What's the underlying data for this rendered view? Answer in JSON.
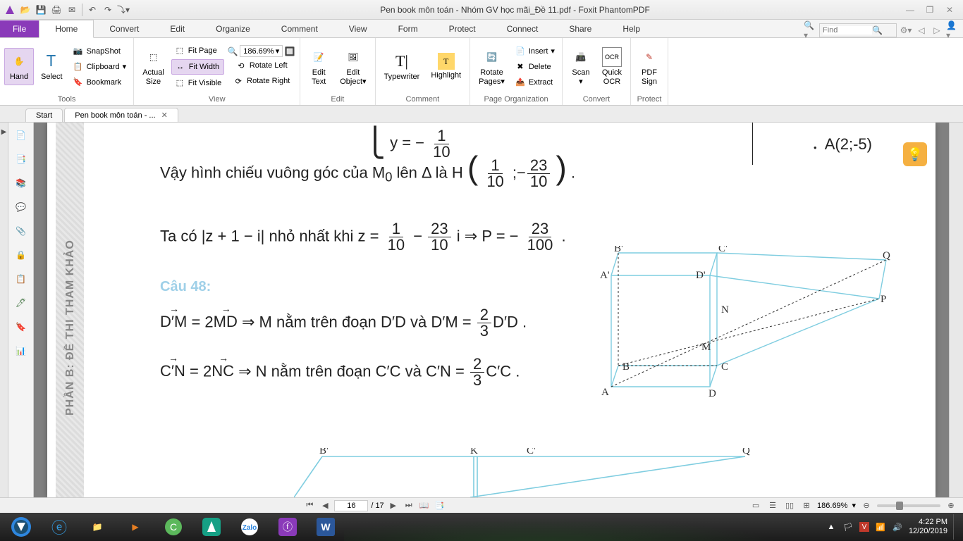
{
  "window": {
    "title": "Pen book môn toán - Nhóm GV học mãi_Đề 11.pdf - Foxit PhantomPDF"
  },
  "ribbon": {
    "file": "File",
    "tabs": [
      "Home",
      "Convert",
      "Edit",
      "Organize",
      "Comment",
      "View",
      "Form",
      "Protect",
      "Connect",
      "Share",
      "Help"
    ],
    "active": "Home",
    "find_placeholder": "Find",
    "zoom_value": "186.69%",
    "groups": {
      "tools": "Tools",
      "view": "View",
      "edit": "Edit",
      "comment": "Comment",
      "page_org": "Page Organization",
      "convert": "Convert",
      "protect": "Protect"
    },
    "btns": {
      "hand": "Hand",
      "select": "Select",
      "snapshot": "SnapShot",
      "clipboard": "Clipboard",
      "bookmark": "Bookmark",
      "actual_size": "Actual\nSize",
      "fit_page": "Fit Page",
      "fit_width": "Fit Width",
      "fit_visible": "Fit Visible",
      "rotate_left": "Rotate Left",
      "rotate_right": "Rotate Right",
      "edit_text": "Edit\nText",
      "edit_object": "Edit\nObject",
      "typewriter": "Typewriter",
      "highlight": "Highlight",
      "rotate_pages": "Rotate\nPages",
      "insert": "Insert",
      "delete": "Delete",
      "extract": "Extract",
      "scan": "Scan",
      "quick_ocr": "Quick\nOCR",
      "pdf_sign": "PDF\nSign"
    }
  },
  "doctabs": {
    "start": "Start",
    "doc": "Pen book môn toán - ..."
  },
  "side_label": "PHẦN B: ĐỀ THI THAM KHẢO",
  "doc": {
    "eq_y": "y = − —10",
    "point_A": "A(2;-5)",
    "line2_pre": "Vậy hình chiếu vuông góc của  M",
    "line2_sub": "0",
    "line2_mid": "  lên  Δ  là  H",
    "h_num1": "1",
    "h_den1": "10",
    "h_sep": ";",
    "h_num2": "23",
    "h_den2": "10",
    "line3_pre": "Ta có ",
    "abs_expr": "|z + 1 − i|",
    "line3_mid": "  nhỏ nhất khi  z = ",
    "z_n1": "1",
    "z_d1": "10",
    "z_minus": " − ",
    "z_n2": "23",
    "z_d2": "10",
    "z_i": "i ⇒ P = −",
    "p_n": "23",
    "p_d": "100",
    "dot": " .",
    "q48": "Câu 48:",
    "dm_l": "D′M",
    "dm_eq": " = 2",
    "md": "MD",
    "dm_arr": "  ⇒ M nằm trên đoạn  D′D  và  D′M = ",
    "dm_n": "2",
    "dm_d": "3",
    "dm_tail": "D′D .",
    "cn_l": "C′N",
    "cn_eq": " = 2",
    "nc": "NC",
    "cn_arr": "  ⇒ N  nằm trên đoạn  C′C  và  C′N = ",
    "cn_n": "2",
    "cn_d": "3",
    "cn_tail": "C′C .",
    "geo_labels": {
      "Bp": "B'",
      "Cp": "C'",
      "Q": "Q",
      "Ap": "A'",
      "Dp": "D'",
      "P": "P",
      "N": "N",
      "M": "M",
      "B": "B",
      "C": "C",
      "A": "A",
      "D": "D",
      "K": "K"
    }
  },
  "status": {
    "page_current": "16",
    "page_total": "/ 17",
    "zoom": "186.69%"
  },
  "systray": {
    "time": "4:22 PM",
    "date": "12/20/2019"
  }
}
